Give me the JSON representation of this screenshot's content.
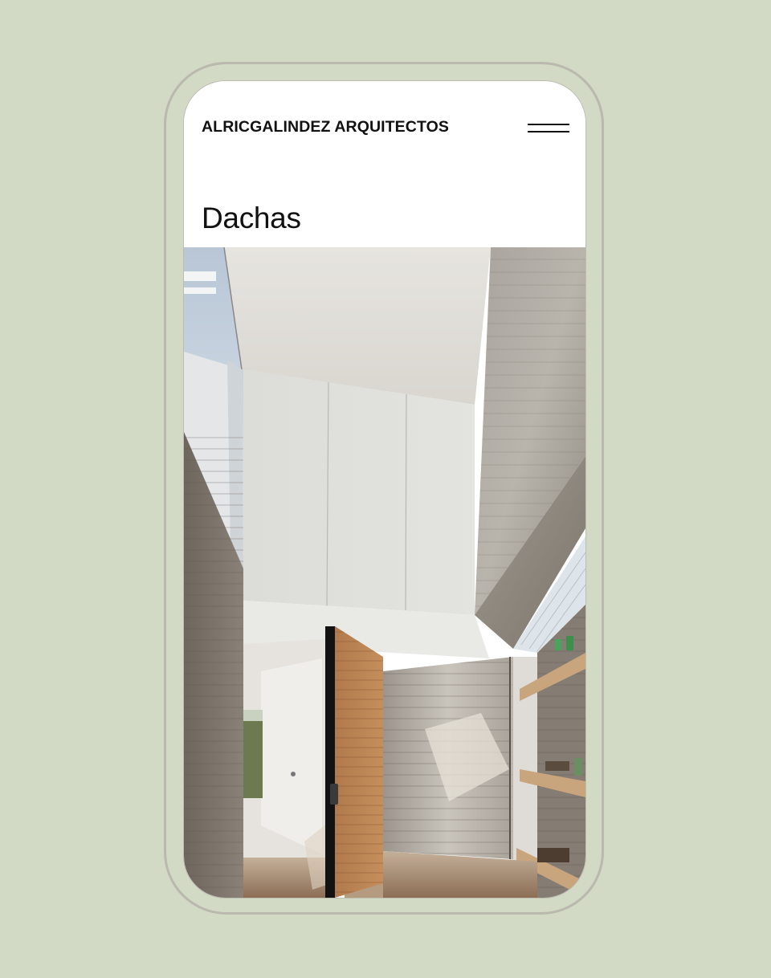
{
  "header": {
    "brand": "ALRICGALINDEZ ARQUITECTOS",
    "menu_icon": "hamburger-menu-icon"
  },
  "page": {
    "title": "Dachas"
  },
  "hero": {
    "alt": "Interior of house with concrete walls, white ceiling and pivoting wooden door"
  },
  "colors": {
    "background": "#d2d9c4",
    "phone_outline": "#b9b9ad",
    "screen": "#ffffff",
    "text": "#111111"
  }
}
